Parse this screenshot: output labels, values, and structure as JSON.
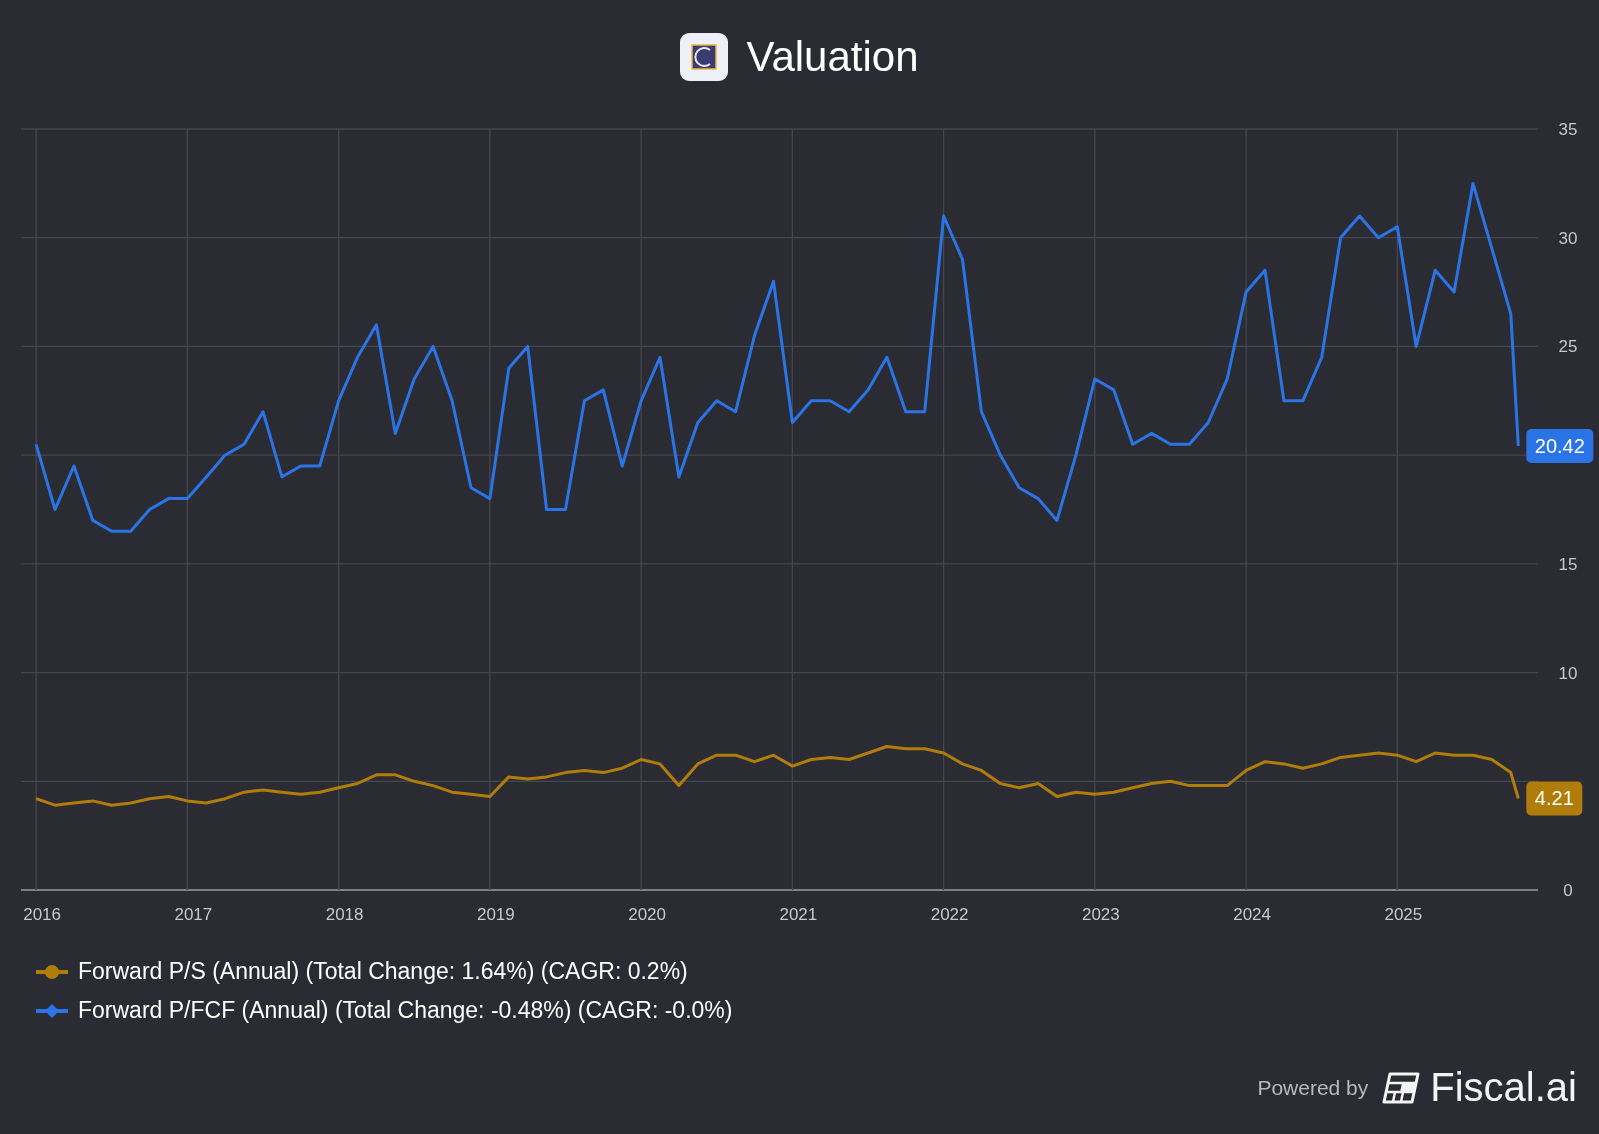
{
  "header": {
    "title": "Valuation"
  },
  "chart": {
    "chart_data": {
      "type": "line",
      "x": [
        2016,
        2016.125,
        2016.25,
        2016.375,
        2016.5,
        2016.625,
        2016.75,
        2016.875,
        2017,
        2017.125,
        2017.25,
        2017.375,
        2017.5,
        2017.625,
        2017.75,
        2017.875,
        2018,
        2018.125,
        2018.25,
        2018.375,
        2018.5,
        2018.625,
        2018.75,
        2018.875,
        2019,
        2019.125,
        2019.25,
        2019.375,
        2019.5,
        2019.625,
        2019.75,
        2019.875,
        2020,
        2020.125,
        2020.25,
        2020.375,
        2020.5,
        2020.625,
        2020.75,
        2020.875,
        2021,
        2021.125,
        2021.25,
        2021.375,
        2021.5,
        2021.625,
        2021.75,
        2021.875,
        2022,
        2022.125,
        2022.25,
        2022.375,
        2022.5,
        2022.625,
        2022.75,
        2022.875,
        2023,
        2023.125,
        2023.25,
        2023.375,
        2023.5,
        2023.625,
        2023.75,
        2023.875,
        2024,
        2024.125,
        2024.25,
        2024.375,
        2024.5,
        2024.625,
        2024.75,
        2024.875,
        2025,
        2025.125,
        2025.25,
        2025.375,
        2025.5,
        2025.625,
        2025.75,
        2025.8
      ],
      "series": [
        {
          "name": "Forward P/S (Annual) (Total Change: 1.64%) (CAGR: 0.2%)",
          "color": "#b07d0a",
          "values": [
            4.2,
            3.9,
            4.0,
            4.1,
            3.9,
            4.0,
            4.2,
            4.3,
            4.1,
            4.0,
            4.2,
            4.5,
            4.6,
            4.5,
            4.4,
            4.5,
            4.7,
            4.9,
            5.3,
            5.3,
            5.0,
            4.8,
            4.5,
            4.4,
            4.3,
            5.2,
            5.1,
            5.2,
            5.4,
            5.5,
            5.4,
            5.6,
            6.0,
            5.8,
            4.8,
            5.8,
            6.2,
            6.2,
            5.9,
            6.2,
            5.7,
            6.0,
            6.1,
            6.0,
            6.3,
            6.6,
            6.5,
            6.5,
            6.3,
            5.8,
            5.5,
            4.9,
            4.7,
            4.9,
            4.3,
            4.5,
            4.4,
            4.5,
            4.7,
            4.9,
            5.0,
            4.8,
            4.8,
            4.8,
            5.5,
            5.9,
            5.8,
            5.6,
            5.8,
            6.1,
            6.2,
            6.3,
            6.2,
            5.9,
            6.3,
            6.2,
            6.2,
            6.0,
            5.4,
            4.21
          ]
        },
        {
          "name": "Forward P/FCF (Annual) (Total Change: -0.48%) (CAGR: -0.0%)",
          "color": "#2a74e6",
          "values": [
            20.5,
            17.5,
            19.5,
            17,
            16.5,
            16.5,
            17.5,
            18,
            18,
            19,
            20,
            20.5,
            22,
            19,
            19.5,
            19.5,
            22.5,
            24.5,
            26,
            21,
            23.5,
            25,
            22.5,
            18.5,
            18,
            24,
            25,
            17.5,
            17.5,
            22.5,
            23,
            19.5,
            22.5,
            24.5,
            19,
            21.5,
            22.5,
            22,
            25.5,
            28,
            21.5,
            22.5,
            22.5,
            22,
            23,
            24.5,
            22,
            22,
            31,
            29,
            22,
            20,
            18.5,
            18,
            17,
            20,
            23.5,
            23,
            20.5,
            21,
            20.5,
            20.5,
            21.5,
            23.5,
            27.5,
            28.5,
            22.5,
            22.5,
            24.5,
            30,
            31,
            30,
            30.5,
            25,
            28.5,
            27.5,
            32.5,
            29.5,
            26.5,
            20.42
          ]
        }
      ],
      "xlim": [
        2015.9,
        2025.93
      ],
      "ylim": [
        0,
        35
      ],
      "xticks": [
        2016,
        2017,
        2018,
        2019,
        2020,
        2021,
        2022,
        2023,
        2024,
        2025
      ],
      "yticks": [
        0,
        10,
        15,
        25,
        30,
        35
      ],
      "grid": true,
      "annotations": [
        {
          "x": 2025.8,
          "y": 4.21,
          "text": "4.21"
        },
        {
          "x": 2025.8,
          "y": 20.42,
          "text": "20.42"
        }
      ]
    }
  },
  "footer": {
    "powered_by": "Powered by",
    "brand": "Fiscal.ai"
  }
}
